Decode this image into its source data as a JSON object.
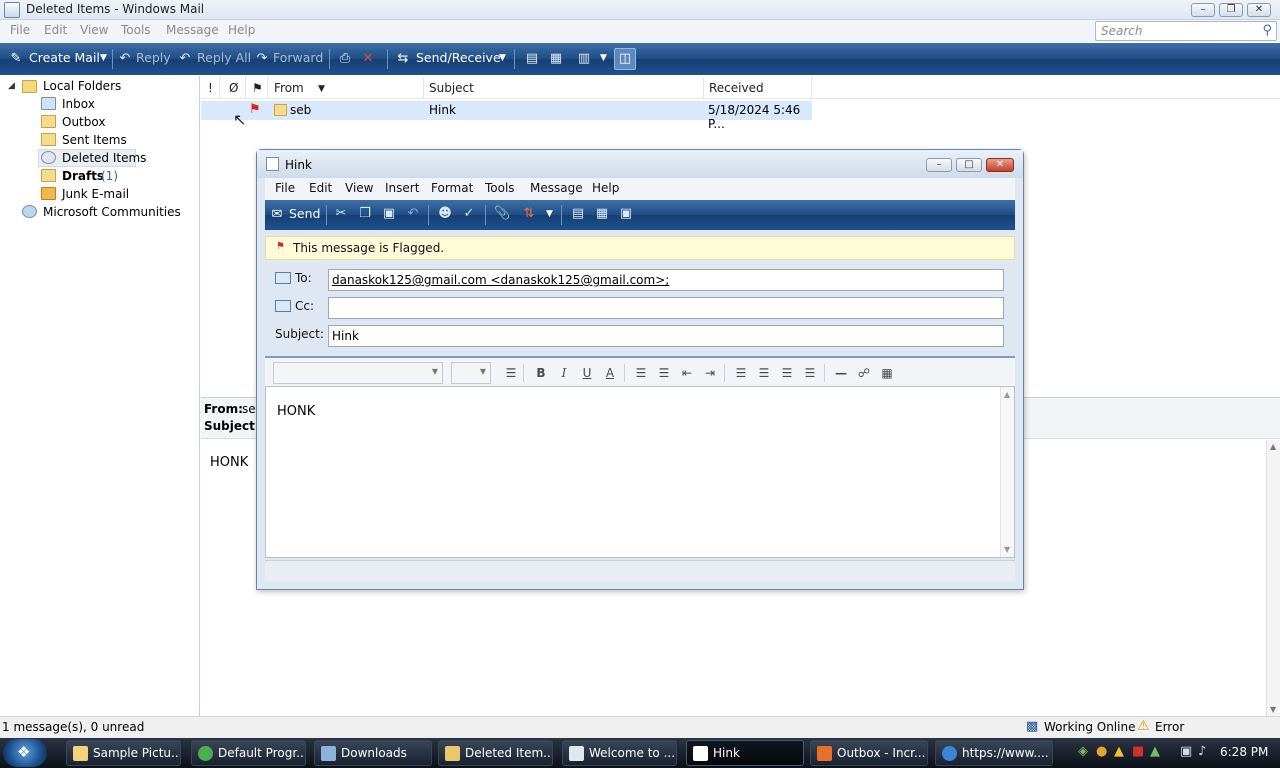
{
  "window": {
    "title": "Deleted Items - Windows Mail"
  },
  "menubar": [
    "File",
    "Edit",
    "View",
    "Tools",
    "Message",
    "Help"
  ],
  "search": {
    "placeholder": "Search"
  },
  "toolbar": {
    "create_mail": "Create Mail",
    "reply": "Reply",
    "reply_all": "Reply All",
    "forward": "Forward",
    "send_receive": "Send/Receive"
  },
  "folders": {
    "root": "Local Folders",
    "items": [
      {
        "label": "Inbox"
      },
      {
        "label": "Outbox"
      },
      {
        "label": "Sent Items"
      },
      {
        "label": "Deleted Items"
      },
      {
        "label": "Drafts",
        "count": "(1)"
      },
      {
        "label": "Junk E-mail"
      }
    ],
    "communities": "Microsoft Communities"
  },
  "list": {
    "headers": {
      "importance": "!",
      "attachment": "Ø",
      "flag": "⚑",
      "from": "From",
      "subject": "Subject",
      "received": "Received"
    },
    "rows": [
      {
        "from": "seb",
        "subject": "Hink",
        "received": "5/18/2024 5:46 P..."
      }
    ]
  },
  "preview": {
    "from_label": "From:",
    "from_value": "seb",
    "subject_label": "Subject:",
    "body": "HONK"
  },
  "status": {
    "left": "1 message(s), 0 unread",
    "working": "Working Online",
    "error": "Error"
  },
  "taskbar": {
    "items": [
      {
        "label": "Sample Pictu..."
      },
      {
        "label": "Default Progr..."
      },
      {
        "label": "Downloads"
      },
      {
        "label": "Deleted Item..."
      },
      {
        "label": "Welcome to ..."
      },
      {
        "label": "Hink"
      },
      {
        "label": "Outbox - Incr..."
      },
      {
        "label": "https://www...."
      }
    ],
    "clock": "6:28 PM"
  },
  "compose": {
    "title": "Hink",
    "menu": [
      "File",
      "Edit",
      "View",
      "Insert",
      "Format",
      "Tools",
      "Message",
      "Help"
    ],
    "send": "Send",
    "flag_notice": "This message is Flagged.",
    "to_label": "To:",
    "to_value": "danaskok125@gmail.com <danaskok125@gmail.com>;",
    "cc_label": "Cc:",
    "cc_value": "",
    "subject_label": "Subject:",
    "subject_value": "Hink",
    "body": "HONK",
    "format_buttons": {
      "bold": "B",
      "italic": "I",
      "underline": "U",
      "font_color": "A"
    }
  },
  "colors": {
    "toolbar_blue": "#1f4d86",
    "selection": "#d9e8fa",
    "flag_red": "#d9261c",
    "notice_yellow": "#fdfbd8"
  }
}
